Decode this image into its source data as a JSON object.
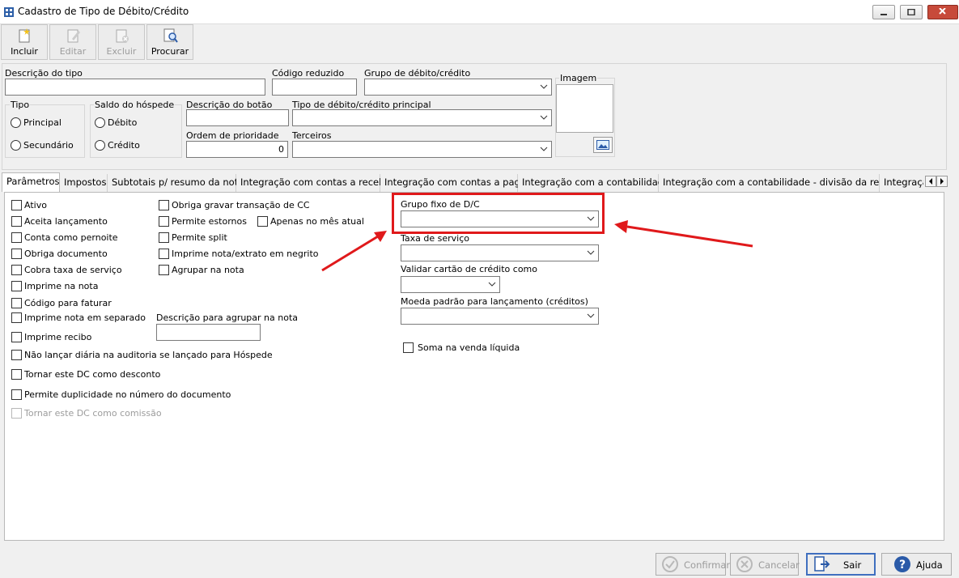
{
  "window": {
    "title": "Cadastro de Tipo de Débito/Crédito"
  },
  "toolbar": {
    "incluir": "Incluir",
    "editar": "Editar",
    "excluir": "Excluir",
    "procurar": "Procurar"
  },
  "form": {
    "descricao_tipo": "Descrição do tipo",
    "codigo_reduzido": "Código reduzido",
    "grupo_debito_credito": "Grupo de débito/crédito",
    "imagem": "Imagem",
    "tipo": {
      "label": "Tipo",
      "principal": "Principal",
      "secundario": "Secundário"
    },
    "saldo_hospede": {
      "label": "Saldo do hóspede",
      "debito": "Débito",
      "credito": "Crédito"
    },
    "descricao_botao": "Descrição do botão",
    "tipo_principal": "Tipo de débito/crédito principal",
    "ordem_prioridade": "Ordem de prioridade",
    "ordem_prioridade_value": "0",
    "terceiros": "Terceiros"
  },
  "tabs": [
    "Parâmetros",
    "Impostos",
    "Subtotais p/ resumo da nota",
    "Integração com contas a receber",
    "Integração com contas a pagar",
    "Integração com a contabilidade",
    "Integração com a contabilidade - divisão da receita",
    "Integraçã"
  ],
  "params": {
    "col1": [
      "Ativo",
      "Aceita lançamento",
      "Conta como pernoite",
      "Obriga documento",
      "Cobra taxa de serviço",
      "Imprime na nota",
      "Código para faturar",
      "Imprime nota em separado",
      "Imprime recibo",
      "Não lançar diária na auditoria se lançado para Hóspede",
      "Tornar este DC como desconto",
      "Permite duplicidade no número do documento",
      "Tornar este DC como comissão"
    ],
    "col2": [
      "Obriga gravar transação de CC",
      "Permite estornos",
      "Permite split",
      "Imprime nota/extrato em negrito",
      "Agrupar na nota"
    ],
    "apenas_mes_atual": "Apenas no mês atual",
    "descricao_agrupar": "Descrição para agrupar na nota",
    "grupo_fixo": "Grupo fixo de D/C",
    "taxa_servico": "Taxa de serviço",
    "validar_cartao": "Validar cartão de crédito como",
    "moeda_padrao": "Moeda padrão para lançamento (créditos)",
    "soma_venda": "Soma na venda líquida"
  },
  "footer": {
    "confirmar": "Confirmar",
    "cancelar": "Cancelar",
    "sair": "Sair",
    "ajuda": "Ajuda"
  },
  "colors": {
    "highlight": "#e0191b",
    "arrow": "#e0191b"
  }
}
